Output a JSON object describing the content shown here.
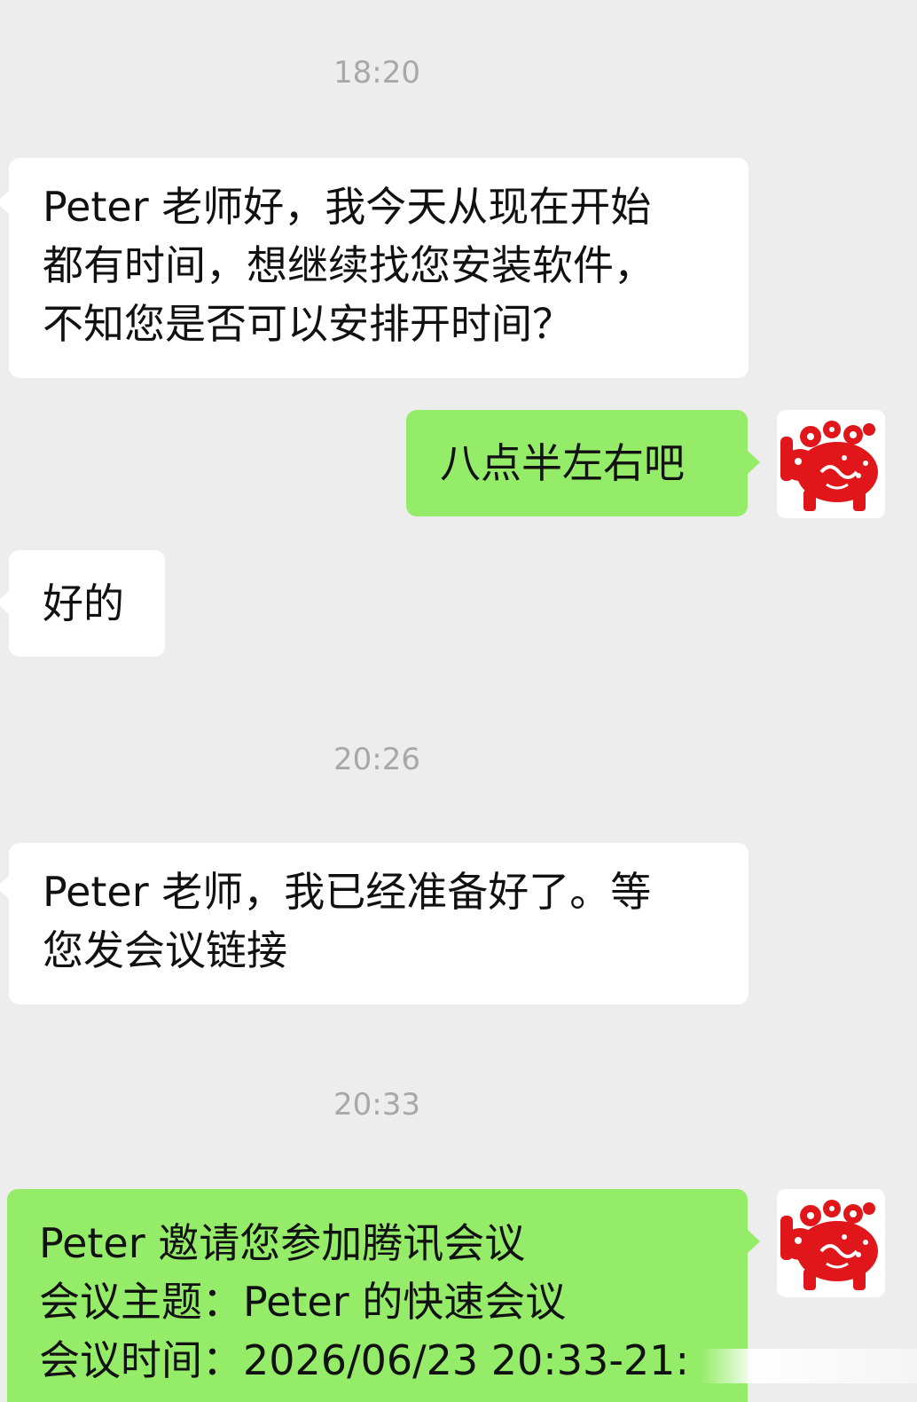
{
  "chat": {
    "messages": [
      {
        "type": "timestamp",
        "text": "18:20"
      },
      {
        "type": "incoming",
        "lines": [
          "Peter 老师好，我今天从现在开始",
          "都有时间，想继续找您安装软件，",
          "不知您是否可以安排开时间？"
        ]
      },
      {
        "type": "outgoing",
        "text": "八点半左右吧",
        "avatar": "paper-cut-pig-avatar"
      },
      {
        "type": "incoming",
        "text": "好的"
      },
      {
        "type": "timestamp",
        "text": "20:26"
      },
      {
        "type": "incoming",
        "lines": [
          "Peter 老师，我已经准备好了。等",
          "您发会议链接"
        ]
      },
      {
        "type": "timestamp",
        "text": "20:33"
      },
      {
        "type": "outgoing",
        "lines": [
          "Peter 邀请您参加腾讯会议",
          "会议主题：Peter 的快速会议",
          "会议时间：2026/06/23 20:33-21:"
        ],
        "avatar": "paper-cut-pig-avatar"
      }
    ]
  },
  "colors": {
    "background": "#ededed",
    "incoming_bubble": "#ffffff",
    "outgoing_bubble": "#95ec69",
    "timestamp_text": "#a8a8a8",
    "avatar_red": "#e0161b"
  }
}
